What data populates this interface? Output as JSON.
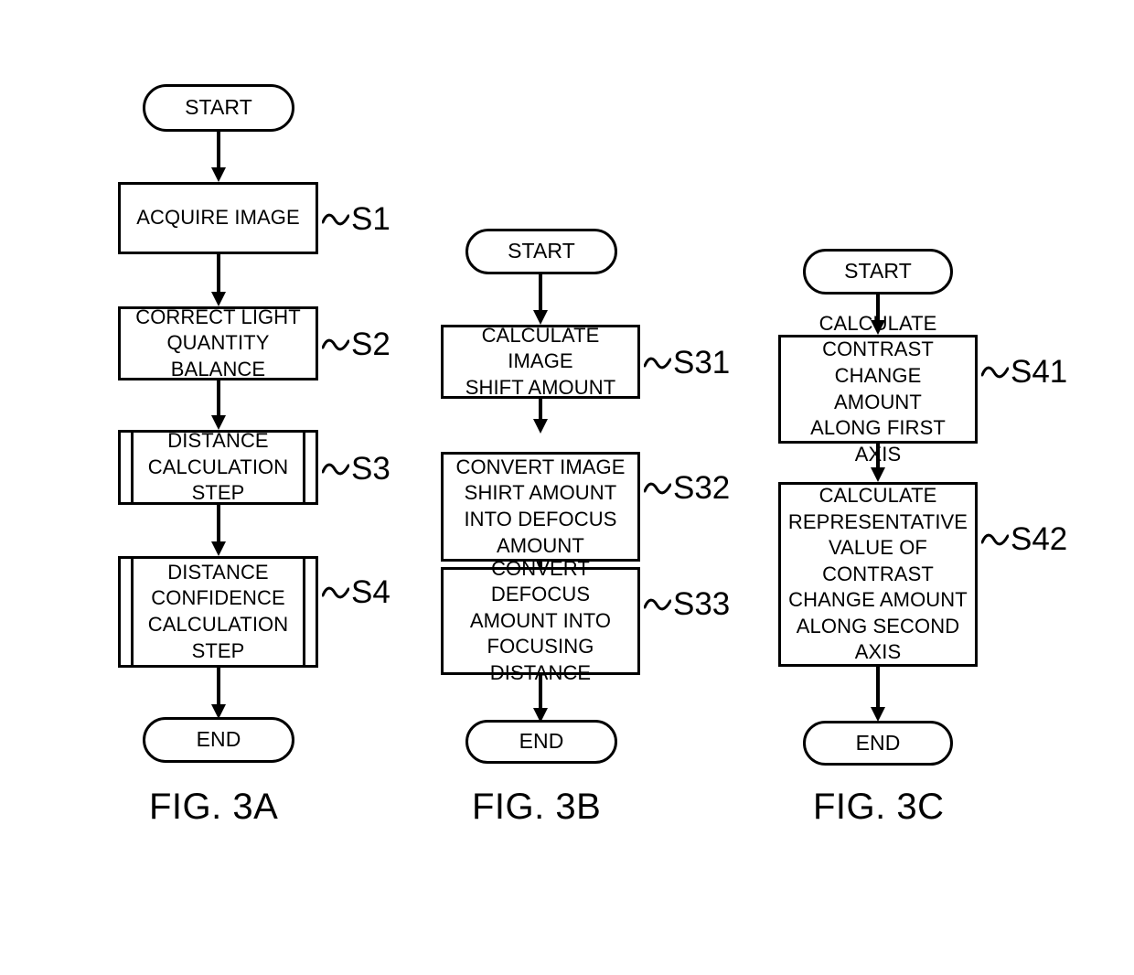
{
  "document": {
    "type": "patent-flowchart-sheet",
    "figure_group": "FIG. 3"
  },
  "figures": [
    {
      "id": "fig-3a",
      "caption": "FIG. 3A",
      "nodes": [
        {
          "id": "a-start",
          "shape": "terminal",
          "label": "START",
          "step": null
        },
        {
          "id": "a-s1",
          "shape": "process",
          "label": "ACQUIRE IMAGE",
          "step": "S1"
        },
        {
          "id": "a-s2",
          "shape": "process",
          "label": "CORRECT LIGHT\nQUANTITY\nBALANCE",
          "step": "S2"
        },
        {
          "id": "a-s3",
          "shape": "predefined",
          "label": "DISTANCE\nCALCULATION\nSTEP",
          "step": "S3"
        },
        {
          "id": "a-s4",
          "shape": "predefined",
          "label": "DISTANCE\nCONFIDENCE\nCALCULATION\nSTEP",
          "step": "S4"
        },
        {
          "id": "a-end",
          "shape": "terminal",
          "label": "END",
          "step": null
        }
      ]
    },
    {
      "id": "fig-3b",
      "caption": "FIG. 3B",
      "nodes": [
        {
          "id": "b-start",
          "shape": "terminal",
          "label": "START",
          "step": null
        },
        {
          "id": "b-s31",
          "shape": "process",
          "label": "CALCULATE IMAGE\nSHIFT AMOUNT",
          "step": "S31"
        },
        {
          "id": "b-s32",
          "shape": "process",
          "label": "CONVERT IMAGE\nSHIRT AMOUNT\nINTO DEFOCUS\nAMOUNT",
          "step": "S32"
        },
        {
          "id": "b-s33",
          "shape": "process",
          "label": "CONVERT DEFOCUS\nAMOUNT INTO\nFOCUSING\nDISTANCE",
          "step": "S33"
        },
        {
          "id": "b-end",
          "shape": "terminal",
          "label": "END",
          "step": null
        }
      ]
    },
    {
      "id": "fig-3c",
      "caption": "FIG. 3C",
      "nodes": [
        {
          "id": "c-start",
          "shape": "terminal",
          "label": "START",
          "step": null
        },
        {
          "id": "c-s41",
          "shape": "process",
          "label": "CALCULATE\nCONTRAST\nCHANGE AMOUNT\nALONG FIRST AXIS",
          "step": "S41"
        },
        {
          "id": "c-s42",
          "shape": "process",
          "label": "CALCULATE\nREPRESENTATIVE\nVALUE OF\nCONTRAST\nCHANGE AMOUNT\nALONG SECOND\nAXIS",
          "step": "S42"
        },
        {
          "id": "c-end",
          "shape": "terminal",
          "label": "END",
          "step": null
        }
      ]
    }
  ],
  "colors": {
    "ink": "#000000",
    "paper": "#ffffff"
  }
}
